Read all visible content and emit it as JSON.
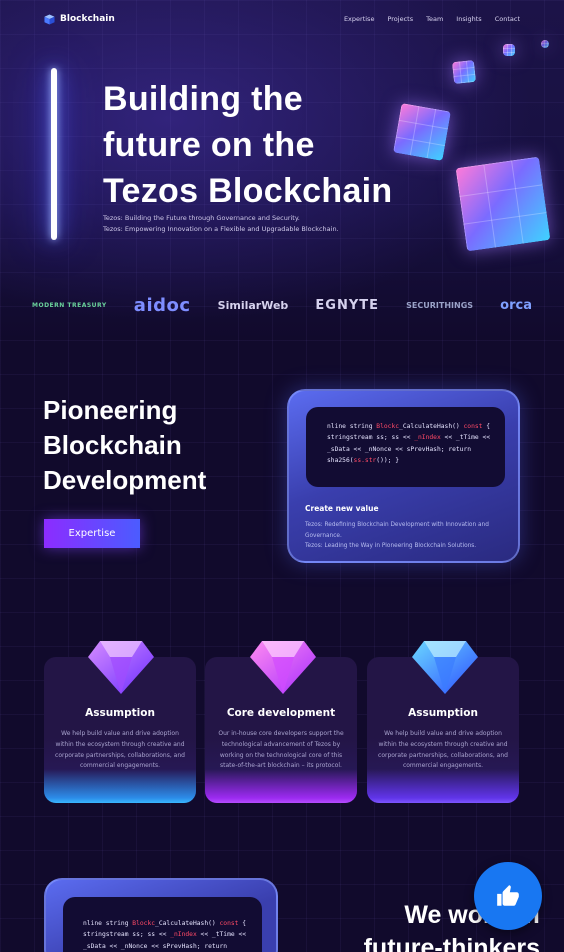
{
  "nav": {
    "brand": "Blockchain",
    "items": [
      "Expertise",
      "Projects",
      "Team",
      "Insights",
      "Contact"
    ]
  },
  "hero": {
    "title_lines": [
      "Building the",
      "future on the",
      "Tezos Blockchain"
    ],
    "sub_lines": [
      "Tezos: Building the Future through Governance and Security.",
      "Tezos: Empowering Innovation on a Flexible and Upgradable Blockchain."
    ]
  },
  "logos": [
    "MODERN TREASURY",
    "aidoc",
    "SimilarWeb",
    "EGNYTE",
    "SECURITHINGS",
    "orca"
  ],
  "pioneering": {
    "title_lines": [
      "Pioneering",
      "Blockchain",
      "Development"
    ],
    "button": "Expertise",
    "code": {
      "line1_pre": "nline string ",
      "line1_hl": "Blockc",
      "line1_post": "_CalculateHash() ",
      "line1_kw": "const",
      "line1_end": " {",
      "line2_pre": "stringstream ss; ss << ",
      "line2_hl": "_nIndex",
      "line2_post": " << _tTime <<",
      "line3": "_sData << _nNonce << sPrevHash; return",
      "line4_pre": "sha256(",
      "line4_hl": "ss.str",
      "line4_post": "()); }"
    },
    "card_title": "Create new value",
    "card_lines": [
      "Tezos: Redefining Blockchain Development with Innovation and Governance.",
      "Tezos: Leading the Way in Pioneering Blockchain Solutions."
    ]
  },
  "features": [
    {
      "title": "Assumption",
      "text": "We help build value and drive adoption within the ecosystem through creative and corporate partnerships, collaborations, and commercial engagements."
    },
    {
      "title": "Core development",
      "text": "Our in-house core developers support the technological advancement of Tezos by working on the technological core of this state-of-the-art blockchain – its protocol."
    },
    {
      "title": "Assumption",
      "text": "We help build value and drive adoption within the ecosystem through creative and corporate partnerships, collaborations, and commercial engagements."
    }
  ],
  "work": {
    "title_lines": [
      "We work wi",
      "future-thinkers"
    ],
    "code": {
      "line1_pre": "nline string ",
      "line1_hl": "Blockc",
      "line1_post": "_CalculateHash() ",
      "line1_kw": "const",
      "line1_end": " {",
      "line2_pre": "stringstream ss; ss << ",
      "line2_hl": "_nIndex",
      "line2_post": " << _tTime <<",
      "line3": "_sData << _nNonce << sPrevHash; return"
    }
  },
  "icons": {
    "brand": "cube-icon",
    "like": "thumbs-up-icon",
    "gems": [
      "diamond-icon",
      "diamond-icon",
      "diamond-icon"
    ]
  },
  "colors": {
    "background": "#110a2c",
    "button_gradient_start": "#8c2cff",
    "button_gradient_end": "#4b5cff",
    "code_highlight": "#ff4a66",
    "like_button": "#1877f2"
  }
}
